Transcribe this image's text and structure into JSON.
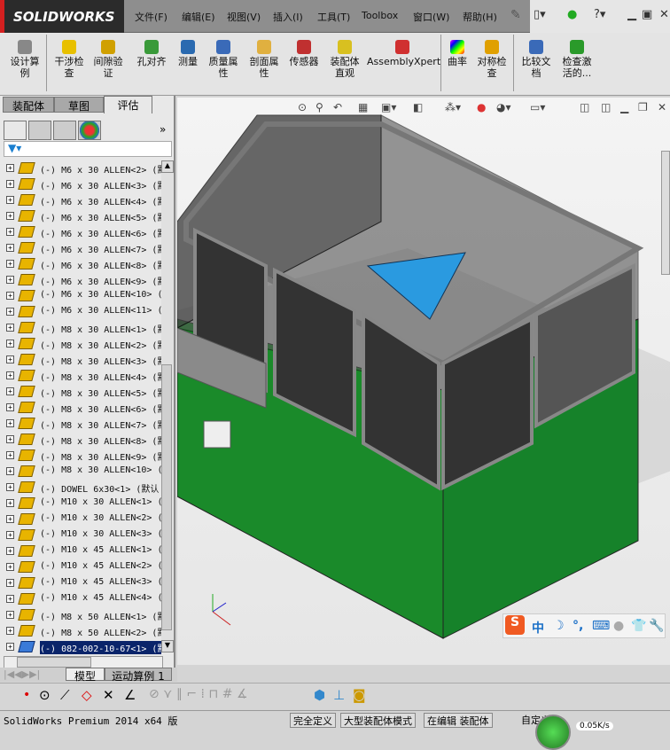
{
  "app": {
    "logo": "SOLIDWORKS"
  },
  "menu": [
    "文件(F)",
    "编辑(E)",
    "视图(V)",
    "插入(I)",
    "工具(T)",
    "Toolbox",
    "窗口(W)",
    "帮助(H)"
  ],
  "ribbon": [
    {
      "label": "设计算例",
      "color": "#888"
    },
    {
      "label": "干涉检查",
      "color": "#e8c000"
    },
    {
      "label": "间隙验证",
      "color": "#d0a000"
    },
    {
      "label": "孔对齐",
      "color": "#3a9a3a"
    },
    {
      "label": "测量",
      "color": "#2a6ab0"
    },
    {
      "label": "质量属性",
      "color": "#3a6ab8"
    },
    {
      "label": "剖面属性",
      "color": "#e0b040"
    },
    {
      "label": "传感器",
      "color": "#c03030"
    },
    {
      "label": "装配体直观",
      "color": "#d8c020"
    },
    {
      "label": "AssemblyXpert",
      "color": "#d03030"
    },
    {
      "label": "曲率",
      "color": "#a040c0"
    },
    {
      "label": "对称检查",
      "color": "#e0a000"
    },
    {
      "label": "比较文档",
      "color": "#3a6ab8"
    },
    {
      "label": "检查激活的...",
      "color": "#2a9a2a"
    }
  ],
  "panel": {
    "tabs": [
      "装配体",
      "草图",
      "评估"
    ],
    "active_tab": "评估",
    "tree": [
      "(-) M6 x 30 ALLEN<2> (默",
      "(-) M6 x 30 ALLEN<3> (默",
      "(-) M6 x 30 ALLEN<4> (默",
      "(-) M6 x 30 ALLEN<5> (默",
      "(-) M6 x 30 ALLEN<6> (默",
      "(-) M6 x 30 ALLEN<7> (默",
      "(-) M6 x 30 ALLEN<8> (默",
      "(-) M6 x 30 ALLEN<9> (默",
      "(-) M6 x 30 ALLEN<10> (",
      "(-) M6 x 30 ALLEN<11> (",
      "(-) M8 x 30 ALLEN<1> (默",
      "(-) M8 x 30 ALLEN<2> (默",
      "(-) M8 x 30 ALLEN<3> (默",
      "(-) M8 x 30 ALLEN<4> (默",
      "(-) M8 x 30 ALLEN<5> (默",
      "(-) M8 x 30 ALLEN<6> (默",
      "(-) M8 x 30 ALLEN<7> (默",
      "(-) M8 x 30 ALLEN<8> (默",
      "(-) M8 x 30 ALLEN<9> (默",
      "(-) M8 x 30 ALLEN<10> (",
      "(-) DOWEL 6x30<1> (默认",
      "(-) M10 x 30 ALLEN<1> (",
      "(-) M10 x 30 ALLEN<2> (",
      "(-) M10 x 30 ALLEN<3> (",
      "(-) M10 x 45 ALLEN<1> (",
      "(-) M10 x 45 ALLEN<2> (",
      "(-) M10 x 45 ALLEN<3> (",
      "(-) M10 x 45 ALLEN<4> (",
      "(-) M8 x 50 ALLEN<1> (默",
      "(-) M8 x 50 ALLEN<2> (默",
      "(-) 082-002-10-67<1> (默"
    ],
    "selected_index": 30,
    "bottom_tabs": [
      "模型",
      "运动算例 1"
    ]
  },
  "status": {
    "app": "SolidWorks Premium 2014 x64 版",
    "fields": [
      "完全定义",
      "大型装配体模式",
      "在编辑 装配体",
      "自定义"
    ],
    "net_speed": "0.05K/s"
  },
  "ime": {
    "lang": "中"
  }
}
